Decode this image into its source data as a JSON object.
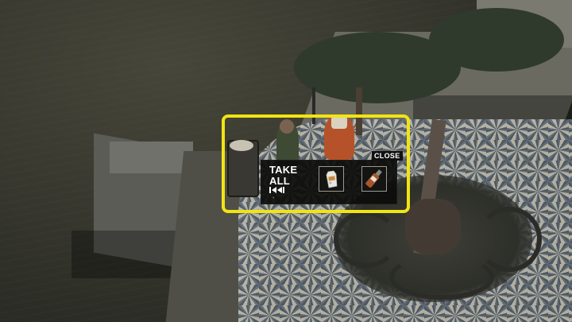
{
  "loot_window": {
    "take_all_line1": "TAKE",
    "take_all_line2": "ALL",
    "close_label": "CLOSE",
    "items": [
      {
        "name": "bottle-can-icon"
      },
      {
        "name": "brown-bottle-icon"
      }
    ]
  },
  "colors": {
    "highlight": "#f1e414",
    "panel": "#0c0c0a"
  }
}
